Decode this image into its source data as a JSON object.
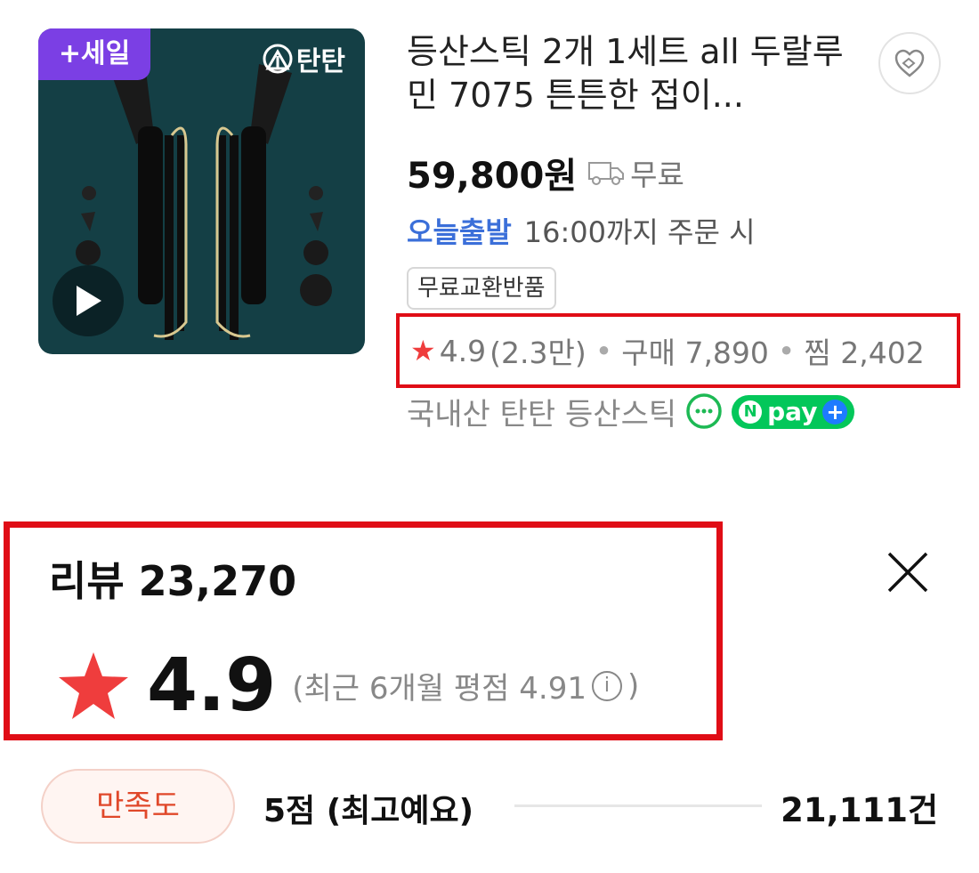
{
  "product": {
    "sale_badge": "+세일",
    "brand": "탄탄",
    "title": "등산스틱 2개 1세트 all 두랄루민 7075 튼튼한 접이...",
    "price": "59,800원",
    "shipping": "무료",
    "delivery": {
      "label": "오늘출발",
      "desc": "16:00까지 주문 시"
    },
    "tag": "무료교환반품",
    "stats": {
      "rating": "4.9",
      "rating_count": "(2.3만)",
      "purchase": "구매 7,890",
      "wish": "찜 2,402"
    },
    "seller": "국내산 탄탄 등산스틱",
    "npay": "pay"
  },
  "review": {
    "title": "리뷰 23,270",
    "score": "4.9",
    "recent": "(최근 6개월 평점 4.91",
    "recent_close": ")",
    "info": "i"
  },
  "satisfaction": {
    "pill": "만족도",
    "label": "5점 (최고예요)",
    "count": "21,111건"
  },
  "colors": {
    "sale_purple": "#7b3fe4",
    "thumb_teal": "#143f45",
    "today_blue": "#3b6fd9",
    "highlight_red": "#e00d16",
    "star_red": "#ef3d3d",
    "npay_green": "#03c75a"
  }
}
